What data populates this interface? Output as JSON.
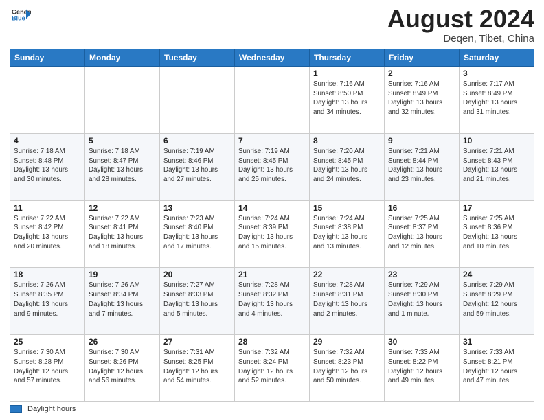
{
  "header": {
    "logo_general": "General",
    "logo_blue": "Blue",
    "month_title": "August 2024",
    "location": "Deqen, Tibet, China"
  },
  "footer": {
    "legend_label": "Daylight hours"
  },
  "calendar": {
    "days_of_week": [
      "Sunday",
      "Monday",
      "Tuesday",
      "Wednesday",
      "Thursday",
      "Friday",
      "Saturday"
    ],
    "weeks": [
      [
        {
          "day": "",
          "info": ""
        },
        {
          "day": "",
          "info": ""
        },
        {
          "day": "",
          "info": ""
        },
        {
          "day": "",
          "info": ""
        },
        {
          "day": "1",
          "info": "Sunrise: 7:16 AM\nSunset: 8:50 PM\nDaylight: 13 hours\nand 34 minutes."
        },
        {
          "day": "2",
          "info": "Sunrise: 7:16 AM\nSunset: 8:49 PM\nDaylight: 13 hours\nand 32 minutes."
        },
        {
          "day": "3",
          "info": "Sunrise: 7:17 AM\nSunset: 8:49 PM\nDaylight: 13 hours\nand 31 minutes."
        }
      ],
      [
        {
          "day": "4",
          "info": "Sunrise: 7:18 AM\nSunset: 8:48 PM\nDaylight: 13 hours\nand 30 minutes."
        },
        {
          "day": "5",
          "info": "Sunrise: 7:18 AM\nSunset: 8:47 PM\nDaylight: 13 hours\nand 28 minutes."
        },
        {
          "day": "6",
          "info": "Sunrise: 7:19 AM\nSunset: 8:46 PM\nDaylight: 13 hours\nand 27 minutes."
        },
        {
          "day": "7",
          "info": "Sunrise: 7:19 AM\nSunset: 8:45 PM\nDaylight: 13 hours\nand 25 minutes."
        },
        {
          "day": "8",
          "info": "Sunrise: 7:20 AM\nSunset: 8:45 PM\nDaylight: 13 hours\nand 24 minutes."
        },
        {
          "day": "9",
          "info": "Sunrise: 7:21 AM\nSunset: 8:44 PM\nDaylight: 13 hours\nand 23 minutes."
        },
        {
          "day": "10",
          "info": "Sunrise: 7:21 AM\nSunset: 8:43 PM\nDaylight: 13 hours\nand 21 minutes."
        }
      ],
      [
        {
          "day": "11",
          "info": "Sunrise: 7:22 AM\nSunset: 8:42 PM\nDaylight: 13 hours\nand 20 minutes."
        },
        {
          "day": "12",
          "info": "Sunrise: 7:22 AM\nSunset: 8:41 PM\nDaylight: 13 hours\nand 18 minutes."
        },
        {
          "day": "13",
          "info": "Sunrise: 7:23 AM\nSunset: 8:40 PM\nDaylight: 13 hours\nand 17 minutes."
        },
        {
          "day": "14",
          "info": "Sunrise: 7:24 AM\nSunset: 8:39 PM\nDaylight: 13 hours\nand 15 minutes."
        },
        {
          "day": "15",
          "info": "Sunrise: 7:24 AM\nSunset: 8:38 PM\nDaylight: 13 hours\nand 13 minutes."
        },
        {
          "day": "16",
          "info": "Sunrise: 7:25 AM\nSunset: 8:37 PM\nDaylight: 13 hours\nand 12 minutes."
        },
        {
          "day": "17",
          "info": "Sunrise: 7:25 AM\nSunset: 8:36 PM\nDaylight: 13 hours\nand 10 minutes."
        }
      ],
      [
        {
          "day": "18",
          "info": "Sunrise: 7:26 AM\nSunset: 8:35 PM\nDaylight: 13 hours\nand 9 minutes."
        },
        {
          "day": "19",
          "info": "Sunrise: 7:26 AM\nSunset: 8:34 PM\nDaylight: 13 hours\nand 7 minutes."
        },
        {
          "day": "20",
          "info": "Sunrise: 7:27 AM\nSunset: 8:33 PM\nDaylight: 13 hours\nand 5 minutes."
        },
        {
          "day": "21",
          "info": "Sunrise: 7:28 AM\nSunset: 8:32 PM\nDaylight: 13 hours\nand 4 minutes."
        },
        {
          "day": "22",
          "info": "Sunrise: 7:28 AM\nSunset: 8:31 PM\nDaylight: 13 hours\nand 2 minutes."
        },
        {
          "day": "23",
          "info": "Sunrise: 7:29 AM\nSunset: 8:30 PM\nDaylight: 13 hours\nand 1 minute."
        },
        {
          "day": "24",
          "info": "Sunrise: 7:29 AM\nSunset: 8:29 PM\nDaylight: 12 hours\nand 59 minutes."
        }
      ],
      [
        {
          "day": "25",
          "info": "Sunrise: 7:30 AM\nSunset: 8:28 PM\nDaylight: 12 hours\nand 57 minutes."
        },
        {
          "day": "26",
          "info": "Sunrise: 7:30 AM\nSunset: 8:26 PM\nDaylight: 12 hours\nand 56 minutes."
        },
        {
          "day": "27",
          "info": "Sunrise: 7:31 AM\nSunset: 8:25 PM\nDaylight: 12 hours\nand 54 minutes."
        },
        {
          "day": "28",
          "info": "Sunrise: 7:32 AM\nSunset: 8:24 PM\nDaylight: 12 hours\nand 52 minutes."
        },
        {
          "day": "29",
          "info": "Sunrise: 7:32 AM\nSunset: 8:23 PM\nDaylight: 12 hours\nand 50 minutes."
        },
        {
          "day": "30",
          "info": "Sunrise: 7:33 AM\nSunset: 8:22 PM\nDaylight: 12 hours\nand 49 minutes."
        },
        {
          "day": "31",
          "info": "Sunrise: 7:33 AM\nSunset: 8:21 PM\nDaylight: 12 hours\nand 47 minutes."
        }
      ]
    ]
  }
}
